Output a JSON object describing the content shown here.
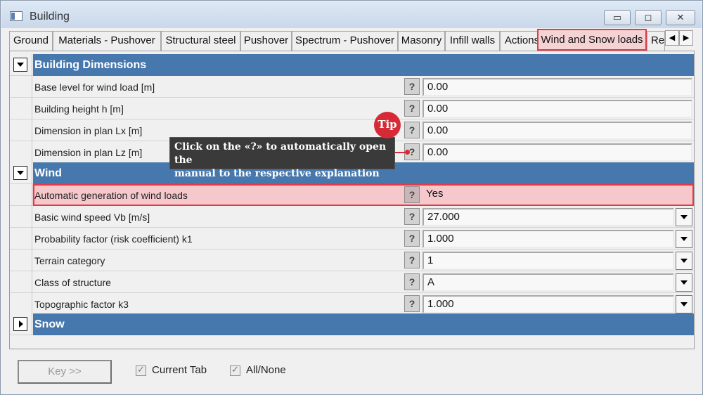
{
  "window": {
    "title": "Building",
    "minimize_glyph": "▭",
    "maximize_glyph": "◻",
    "close_glyph": "✕",
    "icons": {
      "app": "building-app-icon",
      "minimize": "minimize-icon",
      "maximize": "maximize-icon",
      "close": "close-icon"
    }
  },
  "tabs": {
    "items": [
      "Ground",
      "Materials - Pushover",
      "Structural steel",
      "Pushover",
      "Spectrum - Pushover",
      "Masonry",
      "Infill walls",
      "Actions",
      "Wind and Snow loads",
      "Re"
    ],
    "active": "Wind and Snow loads",
    "scroll_left": "◀",
    "scroll_right": "▶"
  },
  "sections": {
    "building_dimensions": {
      "title": "Building Dimensions",
      "rows": [
        {
          "label": "Base level for wind load [m]",
          "help": "?",
          "value": "0.00"
        },
        {
          "label": "Building height h [m]",
          "help": "?",
          "value": "0.00"
        },
        {
          "label": "Dimension in plan Lx [m]",
          "help": "?",
          "value": "0.00"
        },
        {
          "label": "Dimension in plan Lz [m]",
          "help": "?",
          "value": "0.00"
        }
      ]
    },
    "wind": {
      "title": "Wind",
      "rows": [
        {
          "label": "Automatic generation of wind loads",
          "help": "?",
          "value": "Yes"
        },
        {
          "label": "Basic wind speed Vb [m/s]",
          "help": "?",
          "value": "27.000"
        },
        {
          "label": "Probability factor (risk coefficient) k1",
          "help": "?",
          "value": "1.000"
        },
        {
          "label": "Terrain category",
          "help": "?",
          "value": "1"
        },
        {
          "label": "Class of structure",
          "help": "?",
          "value": "A"
        },
        {
          "label": "Topographic factor k3",
          "help": "?",
          "value": "1.000"
        }
      ]
    },
    "snow": {
      "title": "Snow"
    }
  },
  "annotation": {
    "badge": "Tip",
    "text_line1": "Click on the «?» to automatically open the",
    "text_line2": "manual to the respective explanation"
  },
  "footer": {
    "key_button": "Key >>",
    "current_tab": "Current Tab",
    "all_none": "All/None",
    "current_tab_checked": true,
    "all_none_checked": true
  },
  "colors": {
    "section_header": "#4778ad",
    "highlight": "#f5c8cc",
    "highlight_border": "#e33a48",
    "tip_badge": "#d62b37"
  }
}
